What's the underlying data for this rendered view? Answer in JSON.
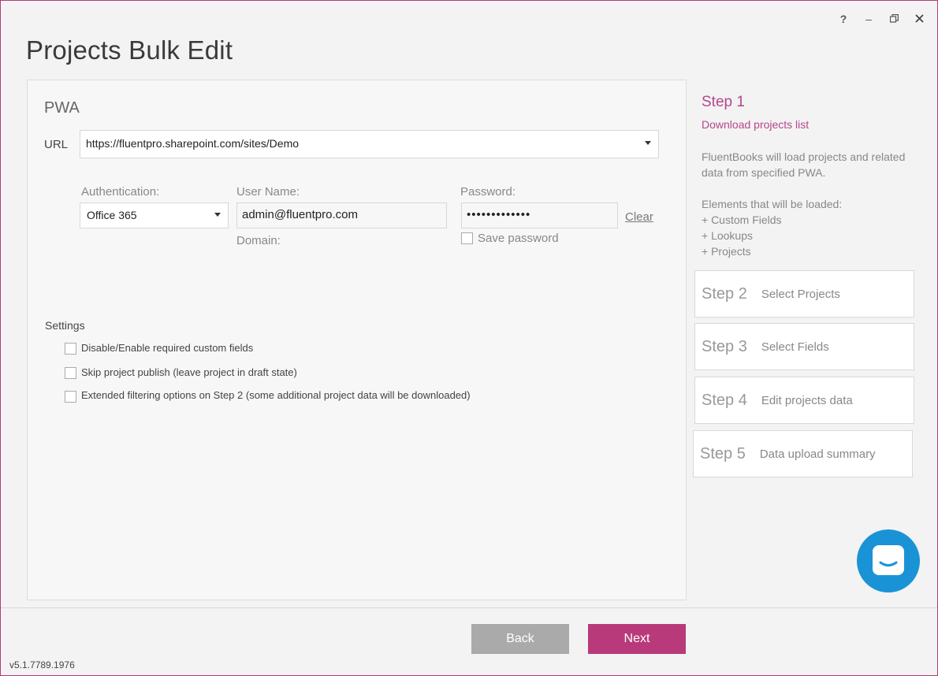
{
  "window": {
    "title": "Projects Bulk Edit",
    "controls": {
      "help": "?",
      "minimize": "–"
    }
  },
  "pwa": {
    "section_title": "PWA",
    "url_label": "URL",
    "url_value": "https://fluentpro.sharepoint.com/sites/Demo",
    "authentication_label": "Authentication:",
    "authentication_value": "Office 365",
    "username_label": "User Name:",
    "username_value": "admin@fluentpro.com",
    "domain_label": "Domain:",
    "password_label": "Password:",
    "password_value": "•••••••••••••",
    "clear_link": "Clear",
    "save_password_label": "Save password",
    "save_password_checked": false
  },
  "settings": {
    "title": "Settings",
    "options": [
      {
        "label": "Disable/Enable required custom fields",
        "checked": false
      },
      {
        "label": "Skip project publish (leave project in draft state)",
        "checked": false
      },
      {
        "label": "Extended filtering options on Step 2 (some additional project data will be downloaded)",
        "checked": false
      }
    ]
  },
  "steps": {
    "current": {
      "title": "Step 1",
      "subtitle": "Download projects list",
      "description": "FluentBooks will load projects and related data from specified PWA.",
      "elements_title": "Elements that will be loaded:",
      "elements": [
        "+ Custom Fields",
        "+ Lookups",
        "+ Projects"
      ]
    },
    "others": [
      {
        "number": "Step 2",
        "name": "Select Projects"
      },
      {
        "number": "Step 3",
        "name": "Select Fields"
      },
      {
        "number": "Step 4",
        "name": "Edit projects data"
      },
      {
        "number": "Step 5",
        "name": "Data upload summary"
      }
    ]
  },
  "footer": {
    "back_label": "Back",
    "next_label": "Next",
    "version": "v5.1.7789.1976"
  },
  "colors": {
    "accent": "#b83a7a",
    "chat": "#1a93d6",
    "back_button": "#aaaaaa"
  }
}
